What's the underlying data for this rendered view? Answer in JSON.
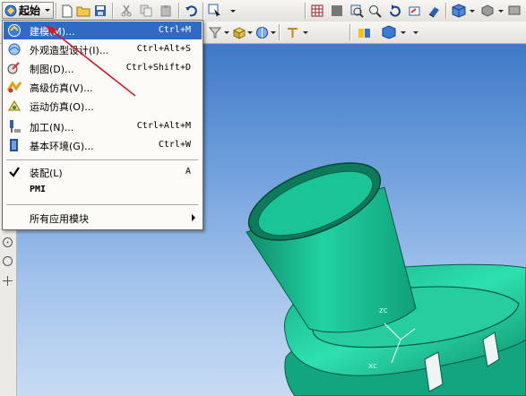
{
  "toolbar": {
    "start_label": "起始"
  },
  "menu": {
    "items": [
      {
        "label": "建模(M)...",
        "shortcut": "Ctrl+M",
        "icon": "modeling-icon"
      },
      {
        "label": "外观造型设计(I)...",
        "shortcut": "Ctrl+Alt+S",
        "icon": "shape-studio-icon"
      },
      {
        "label": "制图(D)...",
        "shortcut": "Ctrl+Shift+D",
        "icon": "drafting-icon"
      },
      {
        "label": "高级仿真(V)...",
        "shortcut": "",
        "icon": "advanced-simulation-icon"
      },
      {
        "label": "运动仿真(O)...",
        "shortcut": "",
        "icon": "motion-simulation-icon"
      },
      {
        "label": "加工(N)...",
        "shortcut": "Ctrl+Alt+M",
        "icon": "manufacturing-icon"
      },
      {
        "label": "基本环境(G)...",
        "shortcut": "Ctrl+W",
        "icon": "gateway-icon"
      }
    ],
    "assembly": {
      "label": "装配(L)",
      "shortcut": "A",
      "icon": "check-icon"
    },
    "pmi_label": "PMI",
    "all_modules_label": "所有应用模块"
  },
  "colors": {
    "highlight": "#316ac5",
    "part": "#1fbf95",
    "background_top": "#3f79c6",
    "annotation_arrow": "#c8202a"
  }
}
